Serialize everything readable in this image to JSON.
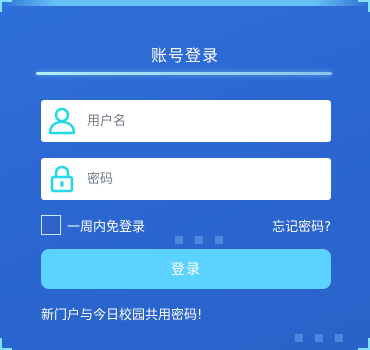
{
  "login": {
    "title": "账号登录",
    "username": {
      "placeholder": "用户名",
      "value": "",
      "icon": "user-icon"
    },
    "password": {
      "placeholder": "密码",
      "value": "",
      "icon": "lock-icon"
    },
    "remember_label": "一周内免登录",
    "remember_checked": false,
    "forgot_label": "忘记密码?",
    "submit_label": "登录",
    "notice": "新门户与今日校园共用密码!"
  },
  "colors": {
    "background": "#2b67d2",
    "accent": "#5bd2ff",
    "icon": "#25d8e6",
    "field": "#ffffff"
  }
}
